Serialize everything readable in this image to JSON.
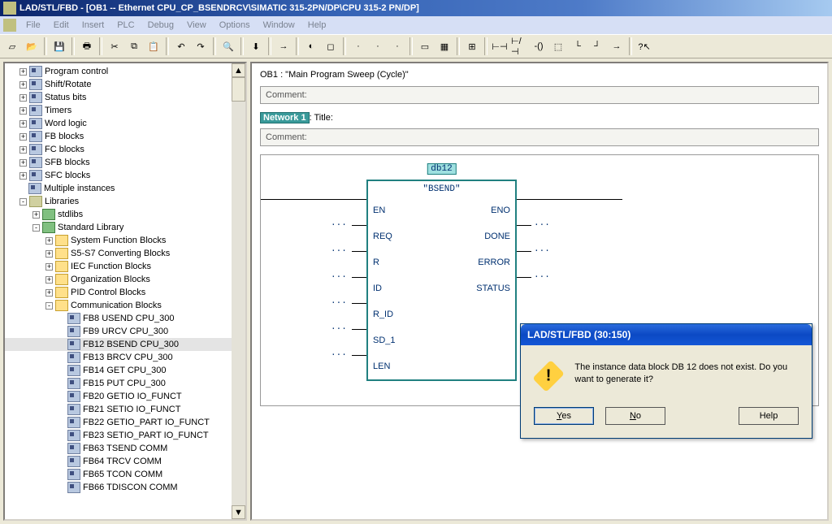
{
  "title": "LAD/STL/FBD  - [OB1 -- Ethernet CPU_CP_BSENDRCV\\SIMATIC 315-2PN/DP\\CPU 315-2 PN/DP]",
  "menu": [
    "File",
    "Edit",
    "Insert",
    "PLC",
    "Debug",
    "View",
    "Options",
    "Window",
    "Help"
  ],
  "tree": [
    {
      "indent": 1,
      "exp": "+",
      "icon": "fb",
      "label": "Program control"
    },
    {
      "indent": 1,
      "exp": "+",
      "icon": "fb",
      "label": "Shift/Rotate"
    },
    {
      "indent": 1,
      "exp": "+",
      "icon": "fb",
      "label": "Status bits"
    },
    {
      "indent": 1,
      "exp": "+",
      "icon": "fb",
      "label": "Timers"
    },
    {
      "indent": 1,
      "exp": "+",
      "icon": "fb",
      "label": "Word logic"
    },
    {
      "indent": 1,
      "exp": "+",
      "icon": "fb",
      "label": "FB blocks"
    },
    {
      "indent": 1,
      "exp": "+",
      "icon": "fb",
      "label": "FC blocks"
    },
    {
      "indent": 1,
      "exp": "+",
      "icon": "fb",
      "label": "SFB blocks"
    },
    {
      "indent": 1,
      "exp": "+",
      "icon": "fb",
      "label": "SFC blocks"
    },
    {
      "indent": 1,
      "exp": "",
      "icon": "fb",
      "label": "Multiple instances"
    },
    {
      "indent": 1,
      "exp": "-",
      "icon": "std",
      "label": "Libraries"
    },
    {
      "indent": 2,
      "exp": "+",
      "icon": "lib",
      "label": "stdlibs"
    },
    {
      "indent": 2,
      "exp": "-",
      "icon": "lib",
      "label": "Standard Library"
    },
    {
      "indent": 3,
      "exp": "+",
      "icon": "folder",
      "label": "System Function Blocks"
    },
    {
      "indent": 3,
      "exp": "+",
      "icon": "folder",
      "label": "S5-S7 Converting Blocks"
    },
    {
      "indent": 3,
      "exp": "+",
      "icon": "folder",
      "label": "IEC Function Blocks"
    },
    {
      "indent": 3,
      "exp": "+",
      "icon": "folder",
      "label": "Organization Blocks"
    },
    {
      "indent": 3,
      "exp": "+",
      "icon": "folder",
      "label": "PID Control Blocks"
    },
    {
      "indent": 3,
      "exp": "-",
      "icon": "folder",
      "label": "Communication Blocks"
    },
    {
      "indent": 4,
      "exp": "",
      "icon": "fb",
      "label": "FB8   USEND   CPU_300"
    },
    {
      "indent": 4,
      "exp": "",
      "icon": "fb",
      "label": "FB9   URCV   CPU_300"
    },
    {
      "indent": 4,
      "exp": "",
      "icon": "fb",
      "label": "FB12   BSEND   CPU_300",
      "sel": true
    },
    {
      "indent": 4,
      "exp": "",
      "icon": "fb",
      "label": "FB13   BRCV   CPU_300"
    },
    {
      "indent": 4,
      "exp": "",
      "icon": "fb",
      "label": "FB14   GET   CPU_300"
    },
    {
      "indent": 4,
      "exp": "",
      "icon": "fb",
      "label": "FB15   PUT   CPU_300"
    },
    {
      "indent": 4,
      "exp": "",
      "icon": "fb",
      "label": "FB20   GETIO   IO_FUNCT"
    },
    {
      "indent": 4,
      "exp": "",
      "icon": "fb",
      "label": "FB21   SETIO   IO_FUNCT"
    },
    {
      "indent": 4,
      "exp": "",
      "icon": "fb",
      "label": "FB22   GETIO_PART   IO_FUNCT"
    },
    {
      "indent": 4,
      "exp": "",
      "icon": "fb",
      "label": "FB23   SETIO_PART   IO_FUNCT"
    },
    {
      "indent": 4,
      "exp": "",
      "icon": "fb",
      "label": "FB63   TSEND   COMM"
    },
    {
      "indent": 4,
      "exp": "",
      "icon": "fb",
      "label": "FB64   TRCV   COMM"
    },
    {
      "indent": 4,
      "exp": "",
      "icon": "fb",
      "label": "FB65   TCON   COMM"
    },
    {
      "indent": 4,
      "exp": "",
      "icon": "fb",
      "label": "FB66   TDISCON   COMM"
    }
  ],
  "ob_header": "OB1 :   \"Main Program Sweep (Cycle)\"",
  "comment": "Comment:",
  "network": "Network 1",
  "network_title": ": Title:",
  "comment2": "Comment:",
  "block": {
    "instance": "db12",
    "name": "\"BSEND\"",
    "left": [
      "EN",
      "REQ",
      "R",
      "ID",
      "R_ID",
      "SD_1",
      "LEN"
    ],
    "right": [
      "ENO",
      "DONE",
      "ERROR",
      "STATUS"
    ]
  },
  "dialog": {
    "title": "LAD/STL/FBD  (30:150)",
    "text": "The instance data block DB 12 does not exist. Do you want to generate it?",
    "yes": "Yes",
    "no": "No",
    "help": "Help"
  },
  "toolbar_icons": [
    "new",
    "open",
    "sep",
    "save",
    "sep",
    "print",
    "sep",
    "cut",
    "copy",
    "paste",
    "sep",
    "undo",
    "redo",
    "sep",
    "find",
    "sep",
    "download",
    "sep",
    "goto",
    "sep",
    "program-status",
    "unused",
    "sep",
    "not-used",
    "not-used",
    "not-used",
    "sep",
    "view-overview",
    "view-detail",
    "sep",
    "ladder-view",
    "sep",
    "contact-no",
    "contact-nc",
    "coil",
    "box",
    "branch-open",
    "branch-close",
    "connector",
    "sep",
    "help-pointer"
  ]
}
